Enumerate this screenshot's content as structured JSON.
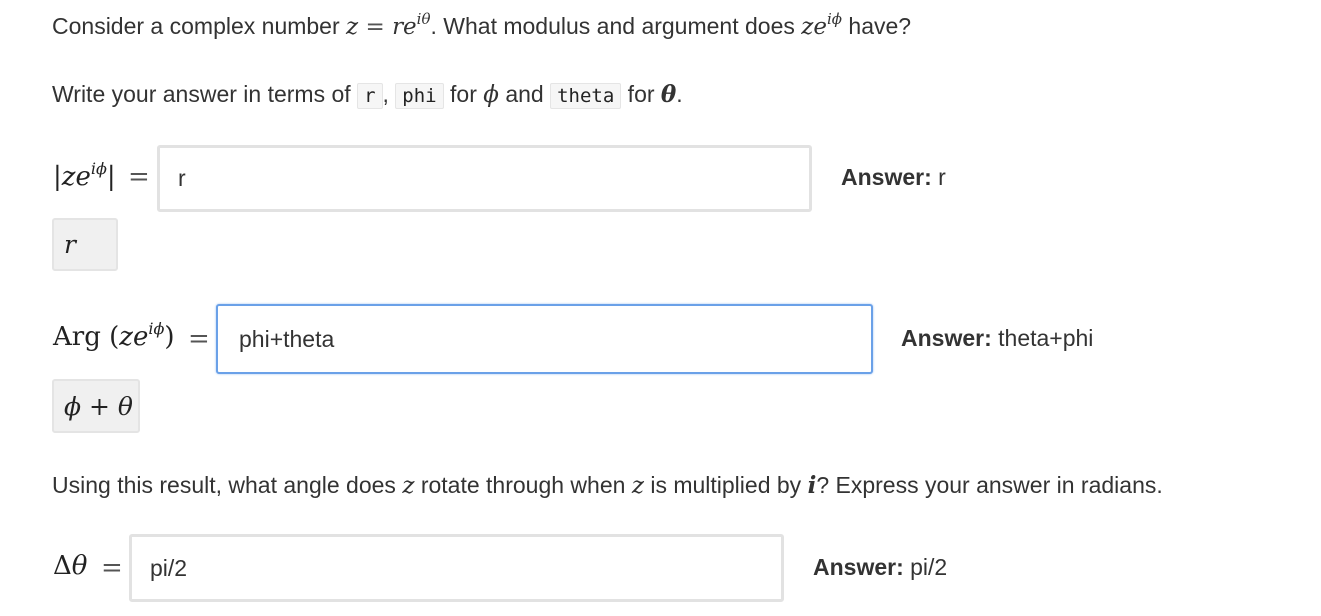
{
  "q1": {
    "text_a": "Consider a complex number ",
    "math_a": "z",
    "math_eq": " = ",
    "math_b": "re",
    "math_b_sup": "iθ",
    "text_b": ". What modulus and argument does ",
    "math_c": "ze",
    "math_c_sup": "iϕ",
    "text_c": " have?"
  },
  "instructions": {
    "text_a": "Write your answer in terms of ",
    "code_r": "r",
    "sep": ", ",
    "code_phi": "phi",
    "text_for1": " for ",
    "sym_phi": "ϕ",
    "text_and": " and ",
    "code_theta": "theta",
    "text_for2": " for ",
    "sym_theta": "θ",
    "text_end": "."
  },
  "modulus": {
    "lhs_open": "|",
    "lhs_base": "ze",
    "lhs_sup": "iϕ",
    "lhs_close": "|",
    "eq": "=",
    "input_value": "r",
    "answer_label": "Answer:",
    "answer_value": " r",
    "preview": "r"
  },
  "argument": {
    "lhs_op": "Arg",
    "lhs_open": " (",
    "lhs_base": "ze",
    "lhs_sup": "iϕ",
    "lhs_close": ")",
    "eq": "=",
    "input_value": "phi+theta",
    "answer_label": "Answer:",
    "answer_value": " theta+phi",
    "preview": "ϕ + θ"
  },
  "q2": {
    "text_a": "Using this result, what angle does ",
    "math_z1": "z",
    "text_b": " rotate through when ",
    "math_z2": "z",
    "text_c": " is multiplied by ",
    "math_i": "i",
    "text_d": "? Express your answer in radians."
  },
  "rotation": {
    "lhs_delta": "Δ",
    "lhs_theta": "θ",
    "eq": "=",
    "input_value": "pi/2",
    "answer_label": "Answer:",
    "answer_value": " pi/2"
  },
  "colors": {
    "focus_border": "#6aa1e8",
    "input_border": "#e2e2e2",
    "preview_bg": "#f0f0f0"
  }
}
